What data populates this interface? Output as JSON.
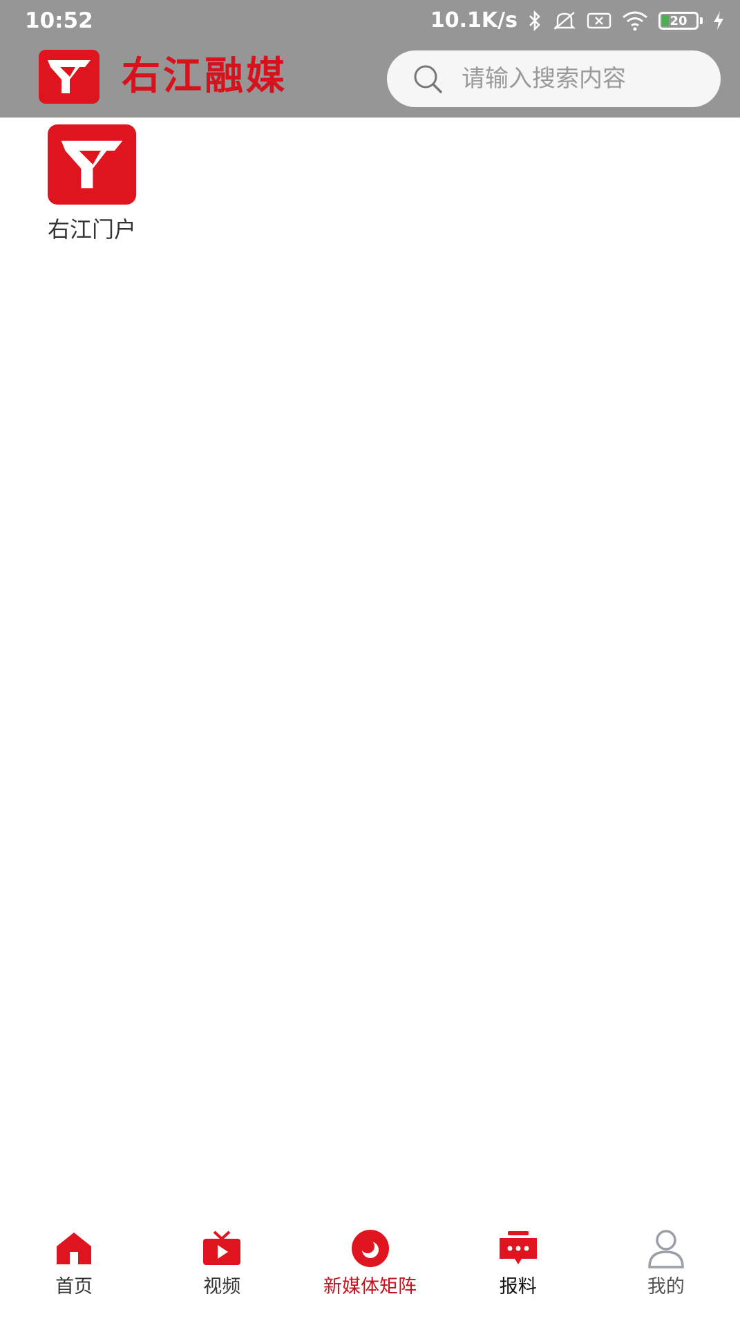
{
  "status_bar": {
    "time": "10:52",
    "net_speed": "10.1K/s",
    "battery_level": "20",
    "icons": [
      "bluetooth-icon",
      "mute-icon",
      "sim-icon",
      "wifi-icon",
      "battery-icon",
      "charging-icon"
    ]
  },
  "header": {
    "brand_title": "右江融媒",
    "search_placeholder": "请输入搜索内容",
    "brand_color": "#e0141e",
    "bar_color": "#969696"
  },
  "main": {
    "items": [
      {
        "label": "右江门户",
        "icon": "youjiang-logo-icon"
      }
    ]
  },
  "bottom_nav": {
    "active_index": 2,
    "active_color": "#c1121f",
    "items": [
      {
        "label": "首页",
        "icon": "home-icon",
        "color": "#333333"
      },
      {
        "label": "视频",
        "icon": "tv-icon",
        "color": "#333333"
      },
      {
        "label": "新媒体矩阵",
        "icon": "media-matrix-icon",
        "color": "#c1121f"
      },
      {
        "label": "报料",
        "icon": "report-chat-icon",
        "color": "#111111"
      },
      {
        "label": "我的",
        "icon": "profile-icon",
        "color": "#555555"
      }
    ]
  }
}
